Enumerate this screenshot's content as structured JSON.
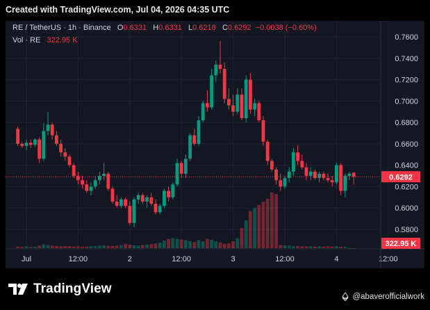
{
  "header": {
    "created_text": "Created with TradingView.com, Jul 04, 2026 04:35 UTC"
  },
  "legend": {
    "symbol": "RE / TetherUS · 1h · Binance",
    "o_label": "O",
    "o_value": "0.6331",
    "h_label": "H",
    "h_value": "0.6331",
    "l_label": "L",
    "l_value": "0.6218",
    "c_label": "C",
    "c_value": "0.6292",
    "change": "−0.0038 (−0.60%)",
    "vol_label": "Vol · RE",
    "vol_value": "322.95 K"
  },
  "colors": {
    "background": "#131722",
    "up": "#089981",
    "down": "#f23645",
    "grid": "#1e222d",
    "text": "#d1d4dc",
    "last_price_line": "#f23645"
  },
  "chart_data": {
    "type": "candlestick",
    "y_axis": {
      "min": 0.57,
      "max": 0.77,
      "ticks": [
        "0.7600",
        "0.7400",
        "0.7200",
        "0.7000",
        "0.6800",
        "0.6600",
        "0.6400",
        "0.6200",
        "0.6000",
        "0.5800"
      ]
    },
    "x_axis": {
      "tick_labels": [
        "Jul",
        "12:00",
        "2",
        "12:00",
        "3",
        "12:00",
        "4",
        "12:00"
      ],
      "tick_positions_hours": [
        0,
        12,
        24,
        36,
        48,
        60,
        72,
        84
      ]
    },
    "last_price_label": "0.6292",
    "volume_label": "322.95 K",
    "candles": [
      {
        "t": -2,
        "o": 0.674,
        "h": 0.676,
        "l": 0.658,
        "c": 0.66
      },
      {
        "t": -1,
        "o": 0.66,
        "h": 0.662,
        "l": 0.656,
        "c": 0.658
      },
      {
        "t": 0,
        "o": 0.658,
        "h": 0.664,
        "l": 0.654,
        "c": 0.661
      },
      {
        "t": 1,
        "o": 0.661,
        "h": 0.664,
        "l": 0.656,
        "c": 0.659
      },
      {
        "t": 2,
        "o": 0.659,
        "h": 0.665,
        "l": 0.657,
        "c": 0.664
      },
      {
        "t": 3,
        "o": 0.664,
        "h": 0.666,
        "l": 0.642,
        "c": 0.646
      },
      {
        "t": 4,
        "o": 0.646,
        "h": 0.679,
        "l": 0.644,
        "c": 0.672
      },
      {
        "t": 5,
        "o": 0.672,
        "h": 0.69,
        "l": 0.668,
        "c": 0.678
      },
      {
        "t": 6,
        "o": 0.678,
        "h": 0.68,
        "l": 0.664,
        "c": 0.668
      },
      {
        "t": 7,
        "o": 0.668,
        "h": 0.672,
        "l": 0.658,
        "c": 0.66
      },
      {
        "t": 8,
        "o": 0.66,
        "h": 0.664,
        "l": 0.648,
        "c": 0.652
      },
      {
        "t": 9,
        "o": 0.652,
        "h": 0.656,
        "l": 0.644,
        "c": 0.648
      },
      {
        "t": 10,
        "o": 0.648,
        "h": 0.65,
        "l": 0.638,
        "c": 0.64
      },
      {
        "t": 11,
        "o": 0.64,
        "h": 0.642,
        "l": 0.628,
        "c": 0.63
      },
      {
        "t": 12,
        "o": 0.63,
        "h": 0.634,
        "l": 0.622,
        "c": 0.626
      },
      {
        "t": 13,
        "o": 0.626,
        "h": 0.63,
        "l": 0.618,
        "c": 0.622
      },
      {
        "t": 14,
        "o": 0.622,
        "h": 0.626,
        "l": 0.614,
        "c": 0.616
      },
      {
        "t": 15,
        "o": 0.616,
        "h": 0.624,
        "l": 0.612,
        "c": 0.62
      },
      {
        "t": 16,
        "o": 0.62,
        "h": 0.63,
        "l": 0.618,
        "c": 0.626
      },
      {
        "t": 17,
        "o": 0.626,
        "h": 0.634,
        "l": 0.622,
        "c": 0.63
      },
      {
        "t": 18,
        "o": 0.63,
        "h": 0.642,
        "l": 0.626,
        "c": 0.632
      },
      {
        "t": 19,
        "o": 0.632,
        "h": 0.634,
        "l": 0.616,
        "c": 0.618
      },
      {
        "t": 20,
        "o": 0.618,
        "h": 0.62,
        "l": 0.604,
        "c": 0.606
      },
      {
        "t": 21,
        "o": 0.606,
        "h": 0.612,
        "l": 0.6,
        "c": 0.602
      },
      {
        "t": 22,
        "o": 0.602,
        "h": 0.61,
        "l": 0.6,
        "c": 0.608
      },
      {
        "t": 23,
        "o": 0.608,
        "h": 0.61,
        "l": 0.6,
        "c": 0.602
      },
      {
        "t": 24,
        "o": 0.602,
        "h": 0.606,
        "l": 0.584,
        "c": 0.586
      },
      {
        "t": 25,
        "o": 0.586,
        "h": 0.61,
        "l": 0.582,
        "c": 0.608
      },
      {
        "t": 26,
        "o": 0.608,
        "h": 0.614,
        "l": 0.604,
        "c": 0.612
      },
      {
        "t": 27,
        "o": 0.612,
        "h": 0.614,
        "l": 0.604,
        "c": 0.606
      },
      {
        "t": 28,
        "o": 0.606,
        "h": 0.612,
        "l": 0.6,
        "c": 0.61
      },
      {
        "t": 29,
        "o": 0.61,
        "h": 0.614,
        "l": 0.602,
        "c": 0.604
      },
      {
        "t": 30,
        "o": 0.604,
        "h": 0.608,
        "l": 0.594,
        "c": 0.596
      },
      {
        "t": 31,
        "o": 0.596,
        "h": 0.604,
        "l": 0.594,
        "c": 0.602
      },
      {
        "t": 32,
        "o": 0.602,
        "h": 0.618,
        "l": 0.6,
        "c": 0.616
      },
      {
        "t": 33,
        "o": 0.616,
        "h": 0.62,
        "l": 0.606,
        "c": 0.61
      },
      {
        "t": 34,
        "o": 0.61,
        "h": 0.624,
        "l": 0.608,
        "c": 0.622
      },
      {
        "t": 35,
        "o": 0.622,
        "h": 0.646,
        "l": 0.62,
        "c": 0.642
      },
      {
        "t": 36,
        "o": 0.642,
        "h": 0.644,
        "l": 0.628,
        "c": 0.632
      },
      {
        "t": 37,
        "o": 0.632,
        "h": 0.65,
        "l": 0.628,
        "c": 0.646
      },
      {
        "t": 38,
        "o": 0.646,
        "h": 0.67,
        "l": 0.644,
        "c": 0.668
      },
      {
        "t": 39,
        "o": 0.668,
        "h": 0.674,
        "l": 0.658,
        "c": 0.66
      },
      {
        "t": 40,
        "o": 0.66,
        "h": 0.686,
        "l": 0.658,
        "c": 0.682
      },
      {
        "t": 41,
        "o": 0.682,
        "h": 0.7,
        "l": 0.68,
        "c": 0.698
      },
      {
        "t": 42,
        "o": 0.698,
        "h": 0.71,
        "l": 0.69,
        "c": 0.694
      },
      {
        "t": 43,
        "o": 0.694,
        "h": 0.73,
        "l": 0.692,
        "c": 0.724
      },
      {
        "t": 44,
        "o": 0.724,
        "h": 0.738,
        "l": 0.718,
        "c": 0.734
      },
      {
        "t": 45,
        "o": 0.734,
        "h": 0.756,
        "l": 0.726,
        "c": 0.73
      },
      {
        "t": 46,
        "o": 0.73,
        "h": 0.736,
        "l": 0.698,
        "c": 0.702
      },
      {
        "t": 47,
        "o": 0.702,
        "h": 0.712,
        "l": 0.692,
        "c": 0.696
      },
      {
        "t": 48,
        "o": 0.696,
        "h": 0.706,
        "l": 0.686,
        "c": 0.69
      },
      {
        "t": 49,
        "o": 0.69,
        "h": 0.712,
        "l": 0.688,
        "c": 0.706
      },
      {
        "t": 50,
        "o": 0.706,
        "h": 0.712,
        "l": 0.682,
        "c": 0.684
      },
      {
        "t": 51,
        "o": 0.684,
        "h": 0.724,
        "l": 0.68,
        "c": 0.72
      },
      {
        "t": 52,
        "o": 0.72,
        "h": 0.726,
        "l": 0.688,
        "c": 0.692
      },
      {
        "t": 53,
        "o": 0.692,
        "h": 0.702,
        "l": 0.686,
        "c": 0.698
      },
      {
        "t": 54,
        "o": 0.698,
        "h": 0.7,
        "l": 0.68,
        "c": 0.682
      },
      {
        "t": 55,
        "o": 0.682,
        "h": 0.686,
        "l": 0.658,
        "c": 0.662
      },
      {
        "t": 56,
        "o": 0.662,
        "h": 0.664,
        "l": 0.64,
        "c": 0.644
      },
      {
        "t": 57,
        "o": 0.644,
        "h": 0.646,
        "l": 0.634,
        "c": 0.636
      },
      {
        "t": 58,
        "o": 0.636,
        "h": 0.638,
        "l": 0.622,
        "c": 0.626
      },
      {
        "t": 59,
        "o": 0.626,
        "h": 0.632,
        "l": 0.616,
        "c": 0.62
      },
      {
        "t": 60,
        "o": 0.62,
        "h": 0.63,
        "l": 0.618,
        "c": 0.628
      },
      {
        "t": 61,
        "o": 0.628,
        "h": 0.638,
        "l": 0.624,
        "c": 0.634
      },
      {
        "t": 62,
        "o": 0.634,
        "h": 0.656,
        "l": 0.63,
        "c": 0.652
      },
      {
        "t": 63,
        "o": 0.652,
        "h": 0.658,
        "l": 0.64,
        "c": 0.644
      },
      {
        "t": 64,
        "o": 0.644,
        "h": 0.65,
        "l": 0.636,
        "c": 0.638
      },
      {
        "t": 65,
        "o": 0.638,
        "h": 0.642,
        "l": 0.626,
        "c": 0.63
      },
      {
        "t": 66,
        "o": 0.63,
        "h": 0.638,
        "l": 0.626,
        "c": 0.634
      },
      {
        "t": 67,
        "o": 0.634,
        "h": 0.636,
        "l": 0.626,
        "c": 0.628
      },
      {
        "t": 68,
        "o": 0.628,
        "h": 0.634,
        "l": 0.624,
        "c": 0.632
      },
      {
        "t": 69,
        "o": 0.632,
        "h": 0.634,
        "l": 0.626,
        "c": 0.628
      },
      {
        "t": 70,
        "o": 0.628,
        "h": 0.632,
        "l": 0.624,
        "c": 0.626
      },
      {
        "t": 71,
        "o": 0.626,
        "h": 0.63,
        "l": 0.62,
        "c": 0.624
      },
      {
        "t": 72,
        "o": 0.624,
        "h": 0.642,
        "l": 0.622,
        "c": 0.64
      },
      {
        "t": 73,
        "o": 0.64,
        "h": 0.642,
        "l": 0.612,
        "c": 0.616
      },
      {
        "t": 74,
        "o": 0.616,
        "h": 0.632,
        "l": 0.61,
        "c": 0.63
      },
      {
        "t": 75,
        "o": 0.63,
        "h": 0.634,
        "l": 0.626,
        "c": 0.632
      },
      {
        "t": 76,
        "o": 0.6331,
        "h": 0.6331,
        "l": 0.6218,
        "c": 0.6292
      }
    ],
    "volumes": [
      0.5,
      0.4,
      0.6,
      0.4,
      0.5,
      0.8,
      1.2,
      1.0,
      0.8,
      0.7,
      0.6,
      0.7,
      0.6,
      0.5,
      0.6,
      0.5,
      0.5,
      0.6,
      0.7,
      0.8,
      0.9,
      0.8,
      0.7,
      0.8,
      1.0,
      1.4,
      1.1,
      0.9,
      0.8,
      1.0,
      1.1,
      1.3,
      1.5,
      1.8,
      2.4,
      3.0,
      3.2,
      3.0,
      2.8,
      2.6,
      2.3,
      2.0,
      2.6,
      2.2,
      3.0,
      2.7,
      2.2,
      1.8,
      1.4,
      1.6,
      2.2,
      3.2,
      6.5,
      9.0,
      12,
      13,
      14,
      15,
      16,
      18,
      17.5,
      1.0,
      0.9,
      0.8,
      0.7,
      0.7,
      0.6,
      0.6,
      0.6,
      0.5,
      0.6,
      0.5,
      0.6,
      0.5,
      0.6,
      0.5,
      0.4
    ]
  },
  "watermark": {
    "brand": "TradingView",
    "credit": "@abaverofficialwork"
  }
}
